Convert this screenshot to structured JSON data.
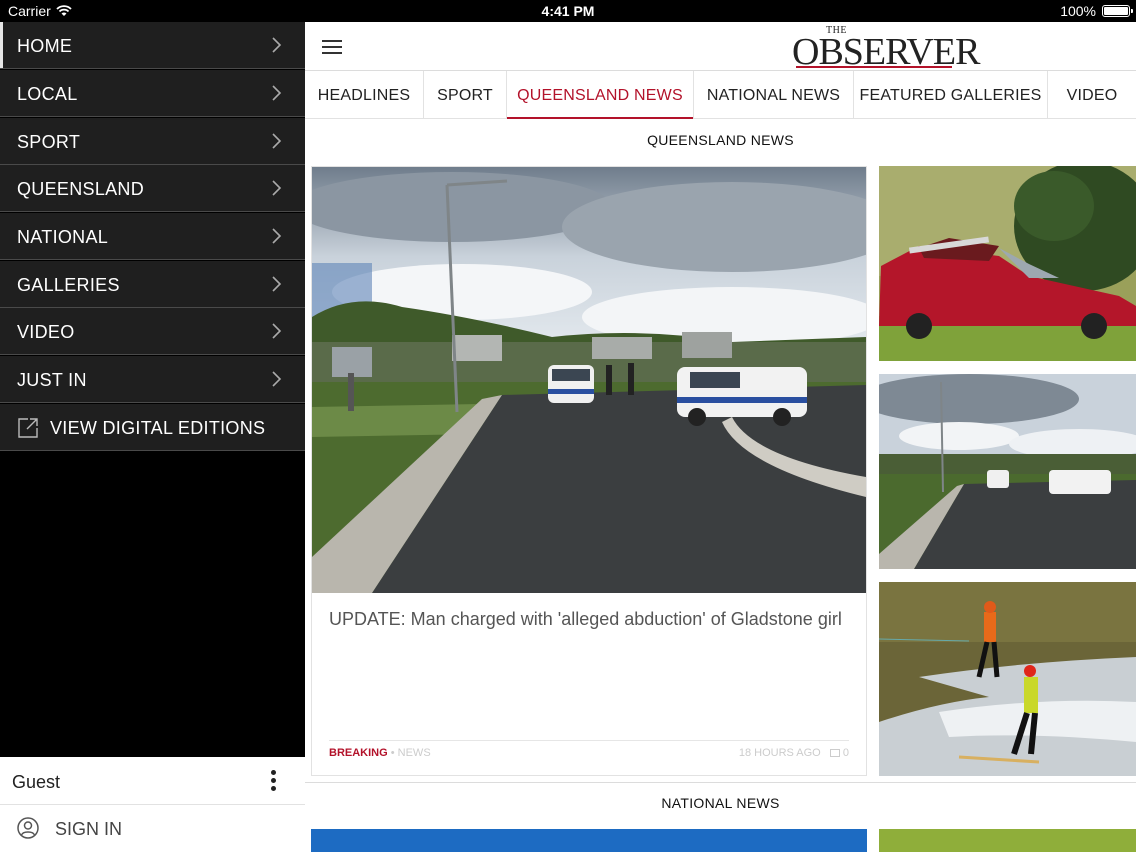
{
  "status_bar": {
    "carrier": "Carrier",
    "time": "4:41 PM",
    "battery": "100%"
  },
  "sidebar": {
    "items": [
      {
        "label": "HOME"
      },
      {
        "label": "LOCAL"
      },
      {
        "label": "SPORT"
      },
      {
        "label": "QUEENSLAND"
      },
      {
        "label": "NATIONAL"
      },
      {
        "label": "GALLERIES"
      },
      {
        "label": "VIDEO"
      },
      {
        "label": "JUST IN"
      }
    ],
    "digital_editions": "VIEW DIGITAL EDITIONS",
    "guest": "Guest",
    "sign_in": "SIGN IN"
  },
  "header": {
    "logo_the": "THE",
    "logo_name": "OBSERVER"
  },
  "tabs": [
    {
      "label": "HEADLINES"
    },
    {
      "label": "SPORT"
    },
    {
      "label": "QUEENSLAND NEWS"
    },
    {
      "label": "NATIONAL NEWS"
    },
    {
      "label": "FEATURED GALLERIES"
    },
    {
      "label": "VIDEO"
    }
  ],
  "sections": {
    "queensland": {
      "title": "QUEENSLAND NEWS",
      "lead": {
        "headline": "UPDATE: Man charged with 'alleged abduction' of Gladstone girl",
        "tag": "BREAKING",
        "separator": "•",
        "category": "NEWS",
        "time": "18 HOURS AGO",
        "comments": "0"
      }
    },
    "national": {
      "title": "NATIONAL NEWS"
    }
  },
  "colors": {
    "accent": "#b3122a",
    "sidebar_bg": "#1f1f1f"
  }
}
